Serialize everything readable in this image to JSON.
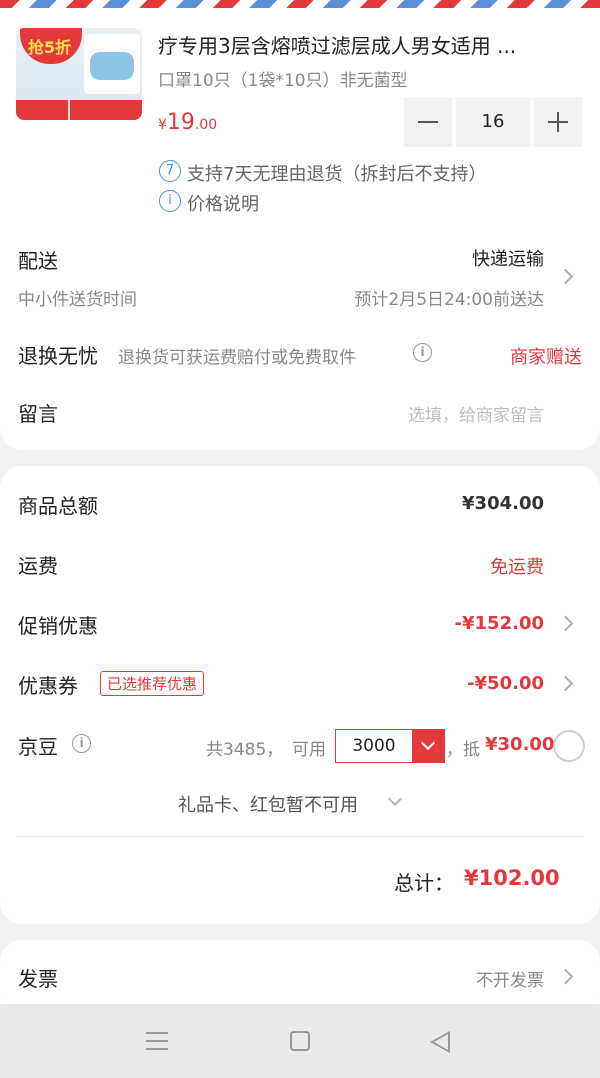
{
  "product": {
    "thumb_badge": "抢5折",
    "title": "疗专用3层含熔喷过滤层成人男女适用 ...",
    "spec": "口罩10只（1袋*10只）非无菌型",
    "price_symbol": "¥",
    "price_int": "19",
    "price_dec": ".00",
    "quantity": "16",
    "return_badge": "7",
    "return_text": "支持7天无理由退货（拆封后不支持）",
    "price_info_icon": "i",
    "price_info_text": "价格说明"
  },
  "delivery": {
    "label": "配送",
    "method": "快递运输",
    "sub_label": "中小件送货时间",
    "eta": "预计2月5日24:00前送达"
  },
  "return_worry_free": {
    "label": "退换无忧",
    "desc": "退换货可获运费赔付或免费取件",
    "info_icon": "i",
    "value": "商家赠送"
  },
  "note": {
    "label": "留言",
    "placeholder": "选填，给商家留言"
  },
  "summary": {
    "goods_total_label": "商品总额",
    "goods_total_value": "¥304.00",
    "shipping_label": "运费",
    "shipping_value": "免运费",
    "promo_label": "促销优惠",
    "promo_value": "-¥152.00",
    "coupon_label": "优惠券",
    "coupon_tag": "已选推荐优惠",
    "coupon_value": "-¥50.00",
    "jingdou_label": "京豆",
    "jingdou_info_icon": "i",
    "jingdou_total": "共3485，",
    "jingdou_available_label": "可用",
    "jingdou_selected": "3000",
    "jingdou_deduct": "，抵",
    "jingdou_deduct_value": "¥30.00",
    "giftcard_text": "礼品卡、红包暂不可用",
    "total_label": "总计：",
    "total_value": "¥102.00"
  },
  "invoice": {
    "label": "发票",
    "value": "不开发票"
  },
  "navbar": {
    "icons": [
      "menu-icon",
      "home-icon",
      "back-icon"
    ]
  },
  "colors": {
    "accent": "#e4393c",
    "info_blue": "#4a8fe0",
    "muted": "#888888"
  }
}
